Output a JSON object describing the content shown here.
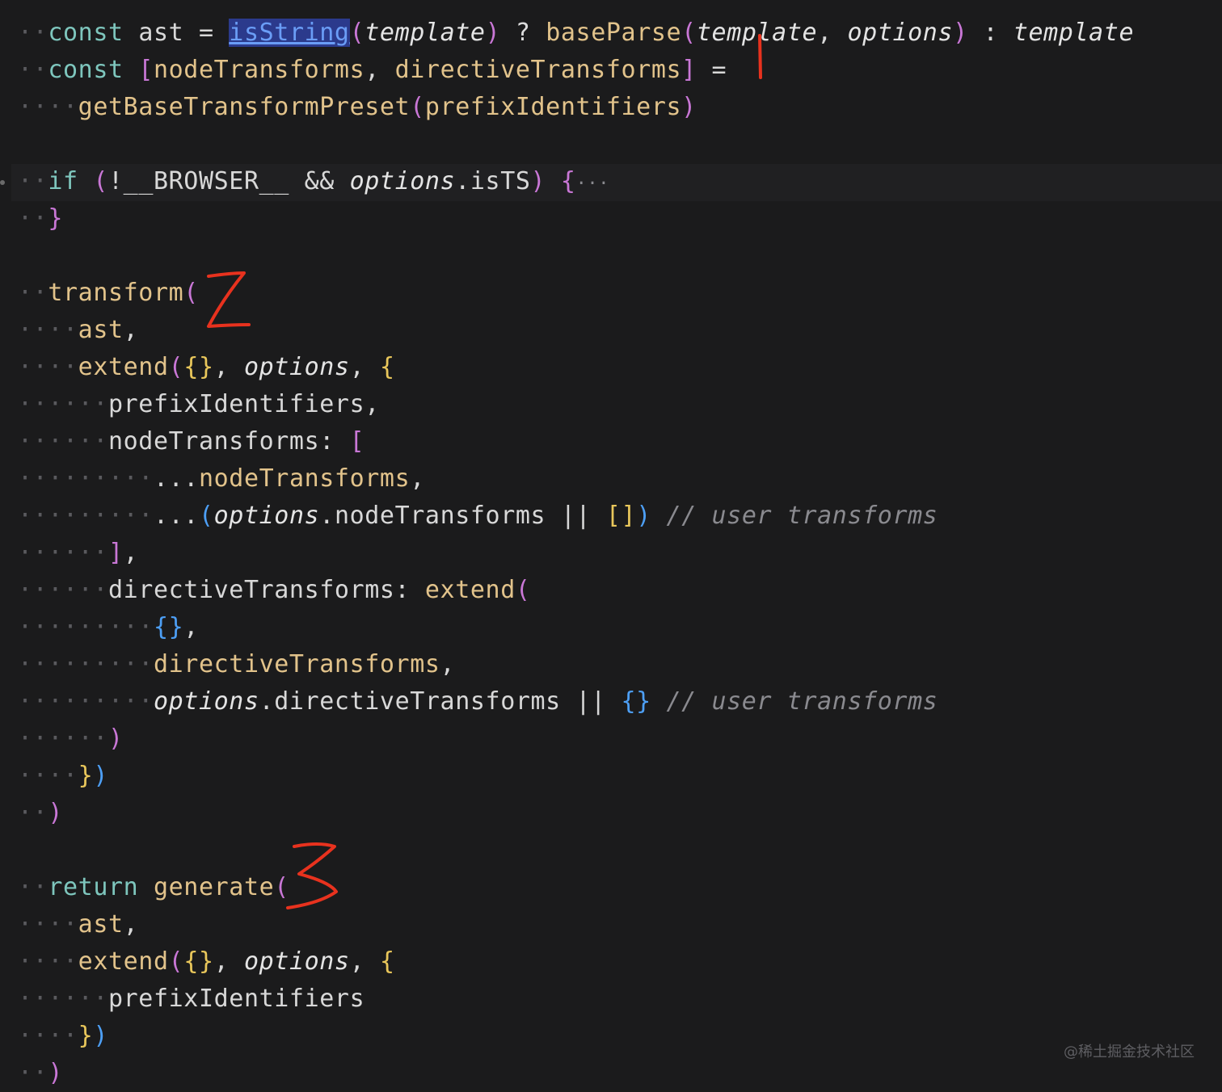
{
  "code": {
    "lines": [
      [
        [
          "ws",
          "··"
        ],
        [
          "kw",
          "const "
        ],
        [
          "pl",
          "ast = "
        ],
        [
          "lnk",
          "isString"
        ],
        [
          "b1",
          "("
        ],
        [
          "it",
          "template"
        ],
        [
          "b1",
          ")"
        ],
        [
          "op",
          " ? "
        ],
        [
          "fn",
          "baseParse"
        ],
        [
          "b1",
          "("
        ],
        [
          "it",
          "template"
        ],
        [
          "pl",
          ", "
        ],
        [
          "it",
          "options"
        ],
        [
          "b1",
          ")"
        ],
        [
          "op",
          " : "
        ],
        [
          "it",
          "template"
        ]
      ],
      [
        [
          "ws",
          "··"
        ],
        [
          "kw",
          "const "
        ],
        [
          "b1",
          "["
        ],
        [
          "fn",
          "nodeTransforms"
        ],
        [
          "pl",
          ", "
        ],
        [
          "fn",
          "directiveTransforms"
        ],
        [
          "b1",
          "]"
        ],
        [
          "pl",
          " ="
        ]
      ],
      [
        [
          "ws",
          "····"
        ],
        [
          "fn",
          "getBaseTransformPreset"
        ],
        [
          "b1",
          "("
        ],
        [
          "fn",
          "prefixIdentifiers"
        ],
        [
          "b1",
          ")"
        ]
      ],
      [],
      [
        [
          "ws",
          "··"
        ],
        [
          "kw",
          "if "
        ],
        [
          "b1",
          "("
        ],
        [
          "pl",
          "!__BROWSER__ && "
        ],
        [
          "it",
          "options"
        ],
        [
          "pl",
          ".isTS"
        ],
        [
          "b1",
          ")"
        ],
        [
          "pl",
          " "
        ],
        [
          "b1",
          "{"
        ],
        [
          "fold",
          "···"
        ]
      ],
      [
        [
          "ws",
          "··"
        ],
        [
          "b1",
          "}"
        ]
      ],
      [],
      [
        [
          "ws",
          "··"
        ],
        [
          "fn",
          "transform"
        ],
        [
          "b1",
          "("
        ]
      ],
      [
        [
          "ws",
          "····"
        ],
        [
          "fn",
          "ast"
        ],
        [
          "pl",
          ","
        ]
      ],
      [
        [
          "ws",
          "····"
        ],
        [
          "fn",
          "extend"
        ],
        [
          "b1",
          "("
        ],
        [
          "b2",
          "{}"
        ],
        [
          "pl",
          ", "
        ],
        [
          "it",
          "options"
        ],
        [
          "pl",
          ", "
        ],
        [
          "b2",
          "{"
        ]
      ],
      [
        [
          "ws",
          "······"
        ],
        [
          "pl",
          "prefixIdentifiers,"
        ]
      ],
      [
        [
          "ws",
          "······"
        ],
        [
          "pl",
          "nodeTransforms: "
        ],
        [
          "b1",
          "["
        ]
      ],
      [
        [
          "ws",
          "·········"
        ],
        [
          "pl",
          "..."
        ],
        [
          "fn",
          "nodeTransforms"
        ],
        [
          "pl",
          ","
        ]
      ],
      [
        [
          "ws",
          "·········"
        ],
        [
          "pl",
          "..."
        ],
        [
          "b3",
          "("
        ],
        [
          "it",
          "options"
        ],
        [
          "pl",
          ".nodeTransforms || "
        ],
        [
          "b2",
          "[]"
        ],
        [
          "b3",
          ")"
        ],
        [
          "pl",
          " "
        ],
        [
          "cm",
          "// user transforms"
        ]
      ],
      [
        [
          "ws",
          "······"
        ],
        [
          "b1",
          "]"
        ],
        [
          "pl",
          ","
        ]
      ],
      [
        [
          "ws",
          "······"
        ],
        [
          "pl",
          "directiveTransforms: "
        ],
        [
          "fn",
          "extend"
        ],
        [
          "b1",
          "("
        ]
      ],
      [
        [
          "ws",
          "·········"
        ],
        [
          "b3",
          "{}"
        ],
        [
          "pl",
          ","
        ]
      ],
      [
        [
          "ws",
          "·········"
        ],
        [
          "fn",
          "directiveTransforms"
        ],
        [
          "pl",
          ","
        ]
      ],
      [
        [
          "ws",
          "·········"
        ],
        [
          "it",
          "options"
        ],
        [
          "pl",
          ".directiveTransforms || "
        ],
        [
          "b3",
          "{}"
        ],
        [
          "pl",
          " "
        ],
        [
          "cm",
          "// user transforms"
        ]
      ],
      [
        [
          "ws",
          "······"
        ],
        [
          "b1",
          ")"
        ]
      ],
      [
        [
          "ws",
          "····"
        ],
        [
          "b2",
          "}"
        ],
        [
          "b3",
          ")"
        ]
      ],
      [
        [
          "ws",
          "··"
        ],
        [
          "b1",
          ")"
        ]
      ],
      [],
      [
        [
          "ws",
          "··"
        ],
        [
          "kw",
          "return "
        ],
        [
          "fn",
          "generate"
        ],
        [
          "b1",
          "("
        ]
      ],
      [
        [
          "ws",
          "····"
        ],
        [
          "fn",
          "ast"
        ],
        [
          "pl",
          ","
        ]
      ],
      [
        [
          "ws",
          "····"
        ],
        [
          "fn",
          "extend"
        ],
        [
          "b1",
          "("
        ],
        [
          "b2",
          "{}"
        ],
        [
          "pl",
          ", "
        ],
        [
          "it",
          "options"
        ],
        [
          "pl",
          ", "
        ],
        [
          "b2",
          "{"
        ]
      ],
      [
        [
          "ws",
          "······"
        ],
        [
          "pl",
          "prefixIdentifiers"
        ]
      ],
      [
        [
          "ws",
          "····"
        ],
        [
          "b2",
          "}"
        ],
        [
          "b3",
          ")"
        ]
      ],
      [
        [
          "ws",
          "··"
        ],
        [
          "b1",
          ")"
        ]
      ]
    ]
  },
  "annotations": [
    {
      "label": "1",
      "color": "#e8321e"
    },
    {
      "label": "2",
      "color": "#e8321e"
    },
    {
      "label": "3",
      "color": "#e8321e"
    }
  ],
  "watermark": "@稀土掘金技术社区",
  "colors": {
    "background": "#1b1b1c",
    "keyword": "#7ec6bd",
    "function": "#e2c38b",
    "bracket_purple": "#c977d6",
    "bracket_yellow": "#e9c75b",
    "bracket_blue": "#4d9ff5",
    "comment": "#8a8a8f"
  }
}
